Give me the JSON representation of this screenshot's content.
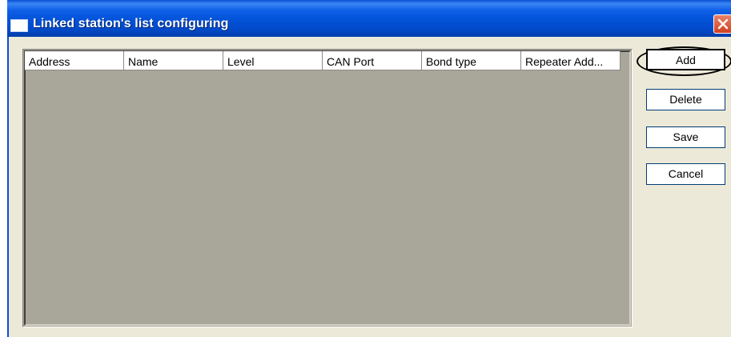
{
  "window": {
    "title": "Linked station's list configuring",
    "close_icon": "close-icon",
    "colors": {
      "titlebar": "#0252d8",
      "list_background": "#a9a69a",
      "dialog_background": "#ece9d8",
      "close_button": "#d2401f"
    }
  },
  "list": {
    "columns": [
      {
        "label": "Address"
      },
      {
        "label": "Name"
      },
      {
        "label": "Level"
      },
      {
        "label": "CAN Port"
      },
      {
        "label": "Bond type"
      },
      {
        "label": "Repeater Add..."
      }
    ],
    "rows": []
  },
  "buttons": {
    "add": "Add",
    "delete": "Delete",
    "save": "Save",
    "cancel": "Cancel"
  }
}
